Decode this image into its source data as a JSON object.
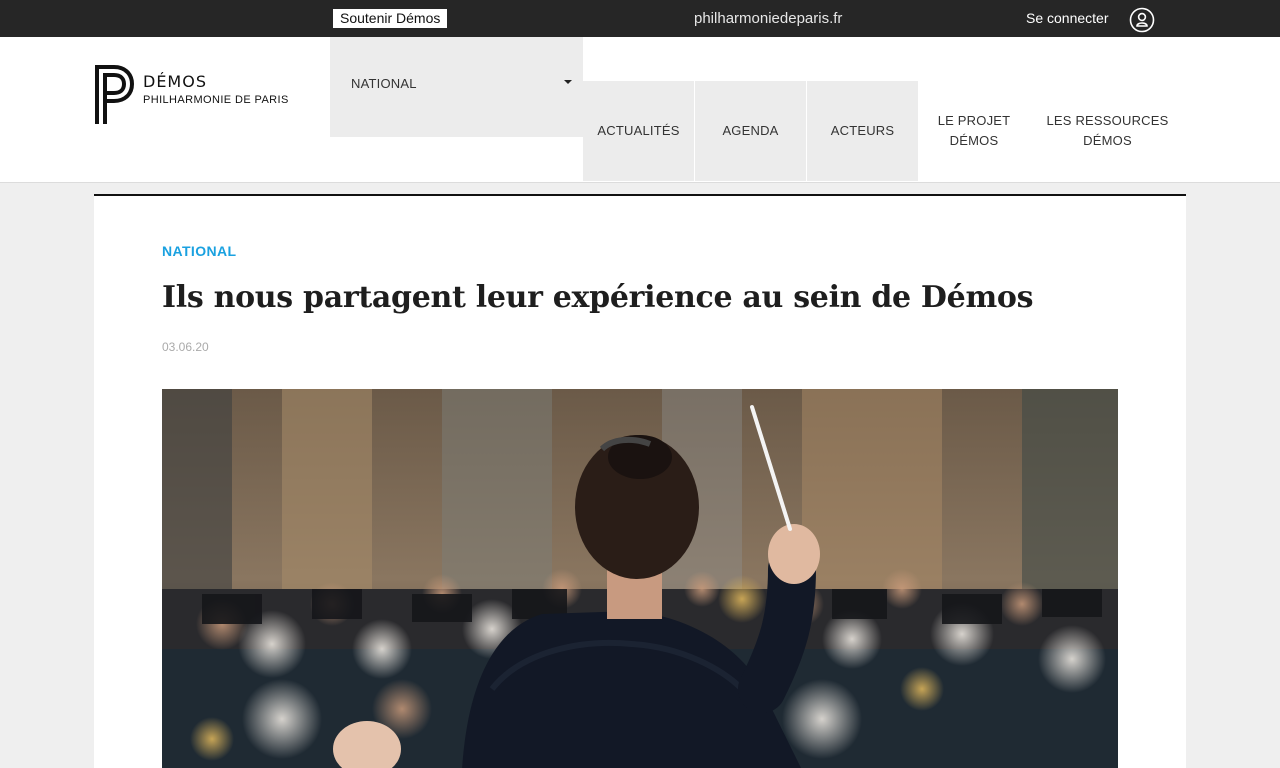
{
  "topbar": {
    "support_label": "Soutenir Démos",
    "site_link": "philharmoniedeparis.fr",
    "login_label": "Se connecter",
    "user_icon": "user-icon"
  },
  "logo": {
    "brand": "DÉMOS",
    "subtitle": "PHILHARMONIE DE PARIS"
  },
  "nav": {
    "region_selected": "NATIONAL",
    "items": [
      {
        "label": "ACTUALITÉS"
      },
      {
        "label": "AGENDA"
      },
      {
        "label": "ACTEURS"
      },
      {
        "label_line1": "LE PROJET",
        "label_line2": "DÉMOS"
      },
      {
        "label_line1": "LES RESSOURCES",
        "label_line2": "DÉMOS"
      }
    ]
  },
  "article": {
    "category": "NATIONAL",
    "title": "Ils nous partagent leur expérience au sein de Démos",
    "date": "03.06.20"
  },
  "colors": {
    "topbar": "#262626",
    "accent": "#1aa1e0",
    "nav_shade": "#ececec"
  }
}
